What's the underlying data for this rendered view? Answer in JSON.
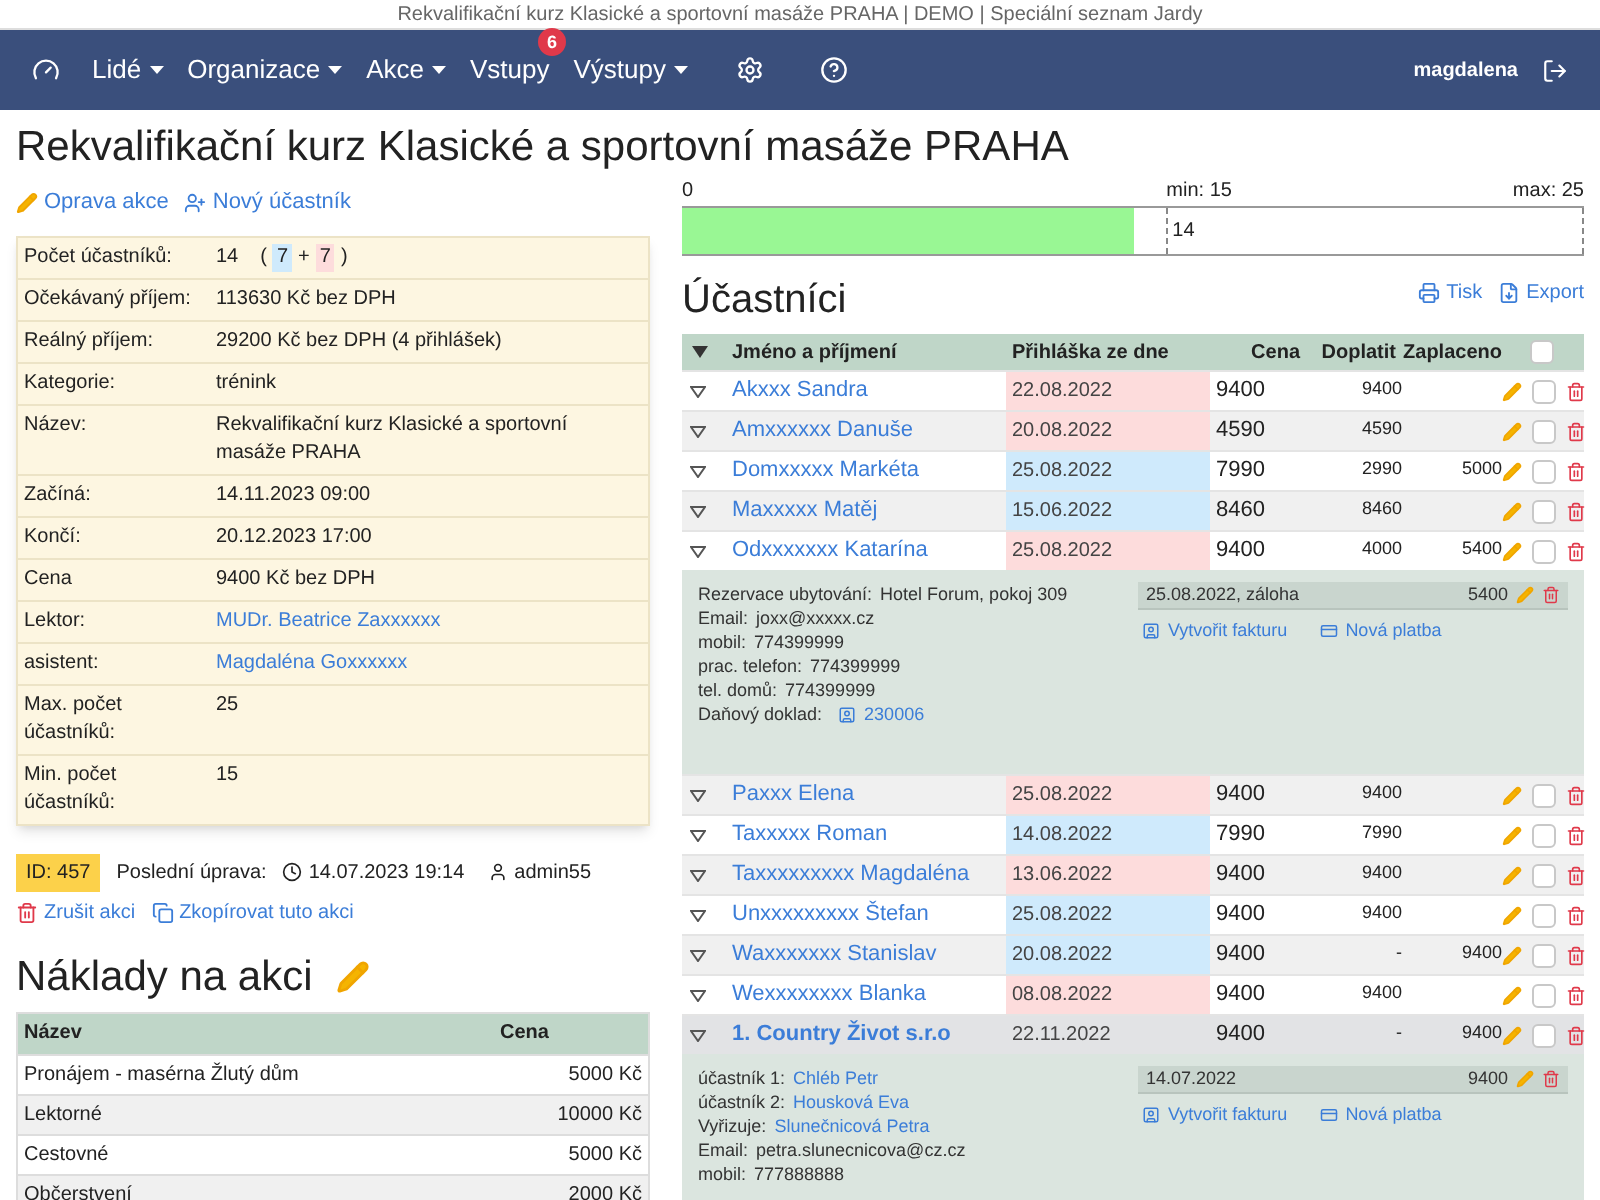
{
  "browser_title": "Rekvalifikační kurz Klasické a sportovní masáže PRAHA | DEMO | Speciální seznam Jardy",
  "nav": {
    "menu": [
      {
        "label": "Lidé",
        "dropdown": true
      },
      {
        "label": "Organizace",
        "dropdown": true
      },
      {
        "label": "Akce",
        "dropdown": true
      },
      {
        "label": "Vstupy",
        "dropdown": false,
        "badge": "6"
      },
      {
        "label": "Výstupy",
        "dropdown": true
      }
    ],
    "user": "magdalena"
  },
  "title": "Rekvalifikační kurz Klasické a sportovní masáže PRAHA",
  "actions": [
    {
      "kind": "edit",
      "label": "Oprava akce"
    },
    {
      "kind": "add_user",
      "label": "Nový účastník"
    }
  ],
  "info": [
    {
      "label": "Počet účastníků:",
      "kind": "text",
      "value": "14",
      "parts": [
        {
          "kind": "text",
          "text": "("
        },
        {
          "kind": "chip",
          "text": "7",
          "color": "#cfeafc"
        },
        {
          "kind": "text",
          "text": "+"
        },
        {
          "kind": "chip",
          "text": "7",
          "color": "#fddcdc"
        },
        {
          "kind": "text",
          "text": ")"
        }
      ]
    },
    {
      "label": "Očekávaný příjem:",
      "kind": "text",
      "value": "113630 Kč bez DPH"
    },
    {
      "label": "Reálný příjem:",
      "kind": "text",
      "value": "29200 Kč bez DPH (4 přihlášek)"
    },
    {
      "label": "Kategorie:",
      "kind": "text",
      "value": "trénink"
    },
    {
      "label": "Název:",
      "kind": "text",
      "value": "Rekvalifikační kurz Klasické a sportovní masáže PRAHA"
    },
    {
      "label": "Začíná:",
      "kind": "text",
      "value": "14.11.2023 09:00"
    },
    {
      "label": "Končí:",
      "kind": "text",
      "value": "20.12.2023 17:00"
    },
    {
      "label": "Cena",
      "kind": "text",
      "value": "9400 Kč bez DPH"
    },
    {
      "label": "Lektor:",
      "kind": "link",
      "value": "MUDr. Beatrice Zaxxxxxx"
    },
    {
      "label": "asistent:",
      "kind": "link",
      "value": "Magdaléna Goxxxxxx"
    },
    {
      "label": "Max. počet účastníků:",
      "kind": "text",
      "value": "25"
    },
    {
      "label": "Min. počet účastníků:",
      "kind": "text",
      "value": "15"
    }
  ],
  "meta": {
    "id": "ID: 457",
    "last_edit_label": "Poslední úprava:",
    "last_edit_time": "14.07.2023 19:14",
    "user": "admin55"
  },
  "event_links": [
    {
      "kind": "delete",
      "label": "Zrušit akci"
    },
    {
      "kind": "copy",
      "label": "Zkopírovat tuto akci"
    }
  ],
  "costs": {
    "title": "Náklady na akci",
    "columns": [
      "Název",
      "Cena"
    ],
    "rows": [
      [
        "Pronájem - masérna Žlutý dům",
        "5000 Kč"
      ],
      [
        "Lektorné",
        "10000 Kč"
      ],
      [
        "Cestovné",
        "5000 Kč"
      ],
      [
        "Občerstvení",
        "2000 Kč"
      ]
    ]
  },
  "capacity": {
    "start": "0",
    "min": "min: 15",
    "max": "max: 25",
    "current": "14",
    "level": 0.5
  },
  "participants": {
    "title": "Účastníci",
    "links": [
      {
        "kind": "print",
        "label": "Tisk"
      },
      {
        "kind": "export",
        "label": "Export"
      }
    ],
    "columns": [
      "Jméno a příjmení",
      "Přihláška ze dne",
      "Cena",
      "Doplatit",
      "Zaplaceno"
    ],
    "header_checked": false,
    "rows": [
      {
        "kind": "person",
        "name": "Akxxx Sandra",
        "date": "22.08.2022",
        "color": "#fddcdc",
        "price": "9400",
        "due": "9400",
        "checked": false
      },
      {
        "kind": "person",
        "name": "Amxxxxxx Danuše",
        "date": "20.08.2022",
        "color": "#fddcdc",
        "price": "4590",
        "due": "4590",
        "checked": false
      },
      {
        "kind": "person",
        "name": "Domxxxxx Markéta",
        "date": "25.08.2022",
        "color": "#cfeafc",
        "price": "7990",
        "due": "2990",
        "paid": "5000",
        "checked": false
      },
      {
        "kind": "person",
        "name": "Maxxxxx Matěj",
        "date": "15.06.2022",
        "color": "#cfeafc",
        "price": "8460",
        "due": "8460",
        "checked": false
      },
      {
        "kind": "person",
        "name": "Odxxxxxxx Katarína",
        "date": "25.08.2022",
        "color": "#fddcdc",
        "price": "9400",
        "due": "4000",
        "paid": "5400",
        "checked": false,
        "details": {
          "lines": [
            {
              "kind": "text",
              "label": "Rezervace ubytování:",
              "value": "Hotel Forum, pokoj 309"
            },
            {
              "kind": "text",
              "label": "Email:",
              "value": "joxx@xxxxx.cz"
            },
            {
              "kind": "text",
              "label": "mobil:",
              "value": "774399999"
            },
            {
              "kind": "text",
              "label": "prac. telefon:",
              "value": "774399999"
            },
            {
              "kind": "text",
              "label": "tel. domů:",
              "value": "774399999"
            },
            {
              "kind": "document",
              "label": "Daňový doklad:",
              "value": "230006"
            }
          ],
          "payments": [
            {
              "text": "25.08.2022, záloha",
              "amount": "5400"
            }
          ],
          "actions": [
            "Vytvořit fakturu",
            "Nová platba"
          ]
        }
      },
      {
        "kind": "person",
        "name": "Paxxx Elena",
        "date": "25.08.2022",
        "color": "#fddcdc",
        "price": "9400",
        "due": "9400",
        "checked": false
      },
      {
        "kind": "person",
        "name": "Taxxxxx Roman",
        "date": "14.08.2022",
        "color": "#cfeafc",
        "price": "7990",
        "due": "7990",
        "checked": false
      },
      {
        "kind": "person",
        "name": "Taxxxxxxxxx Magdaléna",
        "date": "13.06.2022",
        "color": "#fddcdc",
        "price": "9400",
        "due": "9400",
        "checked": false
      },
      {
        "kind": "person",
        "name": "Unxxxxxxxxx Štefan",
        "date": "25.08.2022",
        "color": "#cfeafc",
        "price": "9400",
        "due": "9400",
        "checked": false
      },
      {
        "kind": "person",
        "name": "Waxxxxxxx Stanislav",
        "date": "20.08.2022",
        "color": "#cfeafc",
        "price": "9400",
        "due": "-",
        "paid": "9400",
        "checked": false
      },
      {
        "kind": "person",
        "name": "Wexxxxxxxx Blanka",
        "date": "08.08.2022",
        "color": "#fddcdc",
        "price": "9400",
        "due": "9400",
        "checked": false
      },
      {
        "kind": "company",
        "name": "1. Country Život s.r.o",
        "date": "22.11.2022",
        "price": "9400",
        "due": "-",
        "paid": "9400",
        "checked": false,
        "details": {
          "lines": [
            {
              "kind": "link",
              "label": "účastník 1:",
              "value": "Chléb Petr"
            },
            {
              "kind": "link",
              "label": "účastník 2:",
              "value": "Housková Eva"
            },
            {
              "kind": "link",
              "label": "Vyřizuje:",
              "value": "Slunečnicová Petra"
            },
            {
              "kind": "text",
              "label": "Email:",
              "value": "petra.slunecnicova@cz.cz"
            },
            {
              "kind": "text",
              "label": "mobil:",
              "value": "777888888"
            }
          ],
          "payments": [
            {
              "text": "14.07.2022",
              "amount": "9400"
            }
          ],
          "actions": [
            "Vytvořit fakturu",
            "Nová platba"
          ]
        }
      }
    ]
  }
}
